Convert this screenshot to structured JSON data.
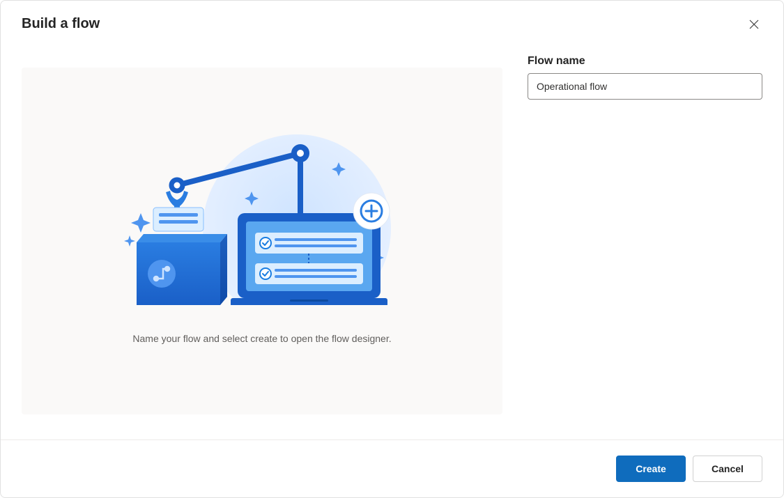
{
  "dialog": {
    "title": "Build a flow",
    "helperText": "Name your flow and select create to open the flow designer."
  },
  "form": {
    "flowNameLabel": "Flow name",
    "flowNameValue": "Operational flow"
  },
  "footer": {
    "createLabel": "Create",
    "cancelLabel": "Cancel"
  }
}
